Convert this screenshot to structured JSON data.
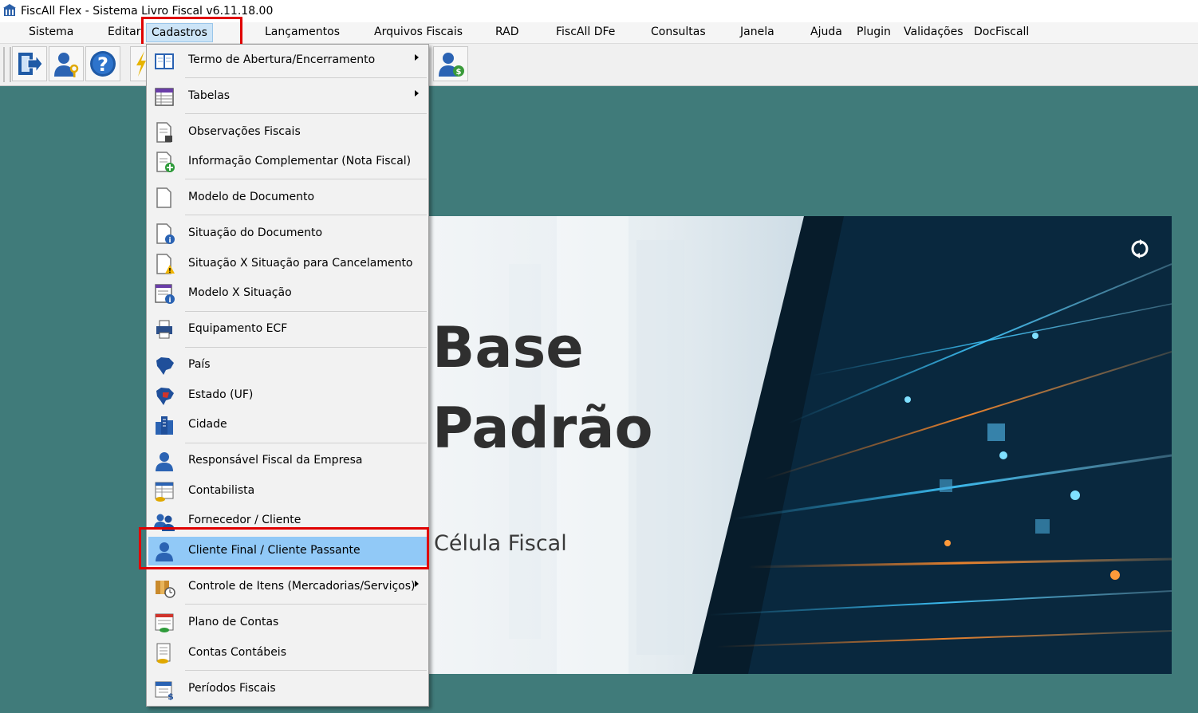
{
  "window": {
    "title": "FiscAll Flex - Sistema Livro Fiscal v6.11.18.00"
  },
  "menubar": {
    "items": [
      {
        "label": "Sistema"
      },
      {
        "label": "Editar"
      },
      {
        "label": "Cadastros"
      },
      {
        "label": "Lançamentos"
      },
      {
        "label": "Arquivos Fiscais"
      },
      {
        "label": "RAD"
      },
      {
        "label": "FiscAll DFe"
      },
      {
        "label": "Consultas"
      },
      {
        "label": "Janela"
      },
      {
        "label": "Ajuda"
      },
      {
        "label": "Plugin"
      },
      {
        "label": "Validações"
      },
      {
        "label": "DocFiscall"
      }
    ],
    "active": "Cadastros"
  },
  "toolbar": {
    "buttons": [
      {
        "icon": "exit-icon"
      },
      {
        "icon": "user-key-icon"
      },
      {
        "icon": "help-icon"
      },
      {
        "icon": "lightning-icon"
      },
      {
        "icon": "user-money-icon"
      }
    ]
  },
  "cadastros_menu": {
    "items": [
      {
        "label": "Termo de Abertura/Encerramento",
        "icon": "book-icon",
        "submenu": true
      },
      {
        "label": "Tabelas",
        "icon": "table-icon",
        "submenu": true
      },
      {
        "label": "Observações Fiscais",
        "icon": "document-search-icon"
      },
      {
        "label": "Informação Complementar (Nota Fiscal)",
        "icon": "document-add-icon"
      },
      {
        "label": "Modelo de Documento",
        "icon": "blank-document-icon"
      },
      {
        "label": "Situação do Documento",
        "icon": "document-info-icon"
      },
      {
        "label": "Situação X Situação para Cancelamento",
        "icon": "document-warning-icon"
      },
      {
        "label": "Modelo X Situação",
        "icon": "list-info-icon"
      },
      {
        "label": "Equipamento ECF",
        "icon": "printer-icon"
      },
      {
        "label": "País",
        "icon": "brazil-map-icon"
      },
      {
        "label": "Estado (UF)",
        "icon": "state-map-icon"
      },
      {
        "label": "Cidade",
        "icon": "city-icon"
      },
      {
        "label": "Responsável Fiscal da Empresa",
        "icon": "person-icon"
      },
      {
        "label": "Contabilista",
        "icon": "accountant-icon"
      },
      {
        "label": "Fornecedor / Cliente",
        "icon": "people-icon"
      },
      {
        "label": "Cliente Final / Cliente Passante",
        "icon": "person-icon",
        "highlighted": true
      },
      {
        "label": "Controle de Itens (Mercadorias/Serviços)",
        "icon": "box-clock-icon",
        "submenu": true
      },
      {
        "label": "Plano de Contas",
        "icon": "ledger-icon"
      },
      {
        "label": "Contas Contábeis",
        "icon": "accounts-icon"
      },
      {
        "label": "Períodos Fiscais",
        "icon": "calendar-money-icon"
      }
    ]
  },
  "splash": {
    "title_line1": "Base",
    "title_line2": "Padrão",
    "subtitle": "Célula Fiscal"
  },
  "colors": {
    "workspace": "#407b7a",
    "highlight": "#91c9f7",
    "annotation": "#e00000"
  }
}
